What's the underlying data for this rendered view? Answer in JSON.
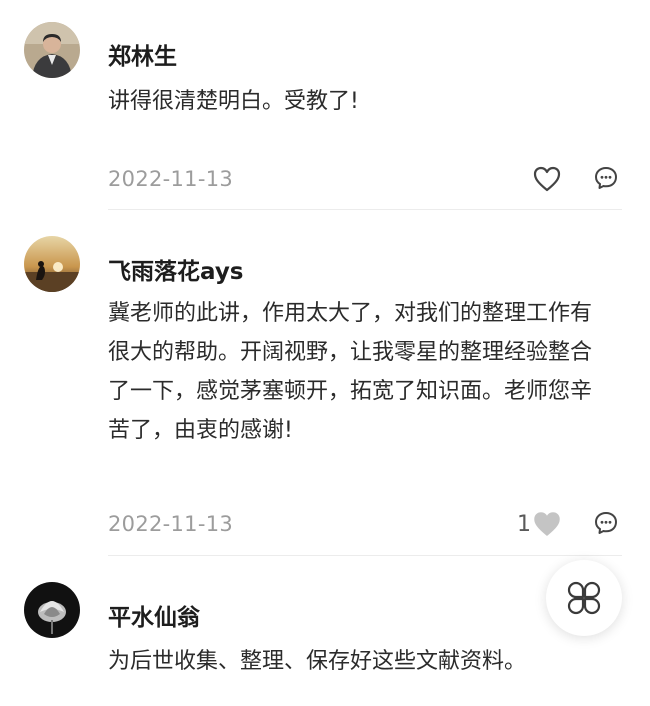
{
  "comments": [
    {
      "author": "郑林生",
      "text": "讲得很清楚明白。受教了!",
      "date": "2022-11-13",
      "like_count": ""
    },
    {
      "author": "飞雨落花ays",
      "text": "冀老师的此讲，作用太大了，对我们的整理工作有很大的帮助。开阔视野，让我零星的整理经验整合了一下，感觉茅塞顿开，拓宽了知识面。老师您辛苦了，由衷的感谢!",
      "date": "2022-11-13",
      "like_count": "1"
    },
    {
      "author": "平水仙翁",
      "text": "为后世收集、整理、保存好这些文献资料。"
    }
  ],
  "icons": {
    "like": "heart-icon",
    "reply": "comment-bubble-icon",
    "menu": "four-leaf-grid-icon"
  },
  "colors": {
    "date": "#9c9c9c",
    "liked_heart": "#c4c4c4"
  }
}
